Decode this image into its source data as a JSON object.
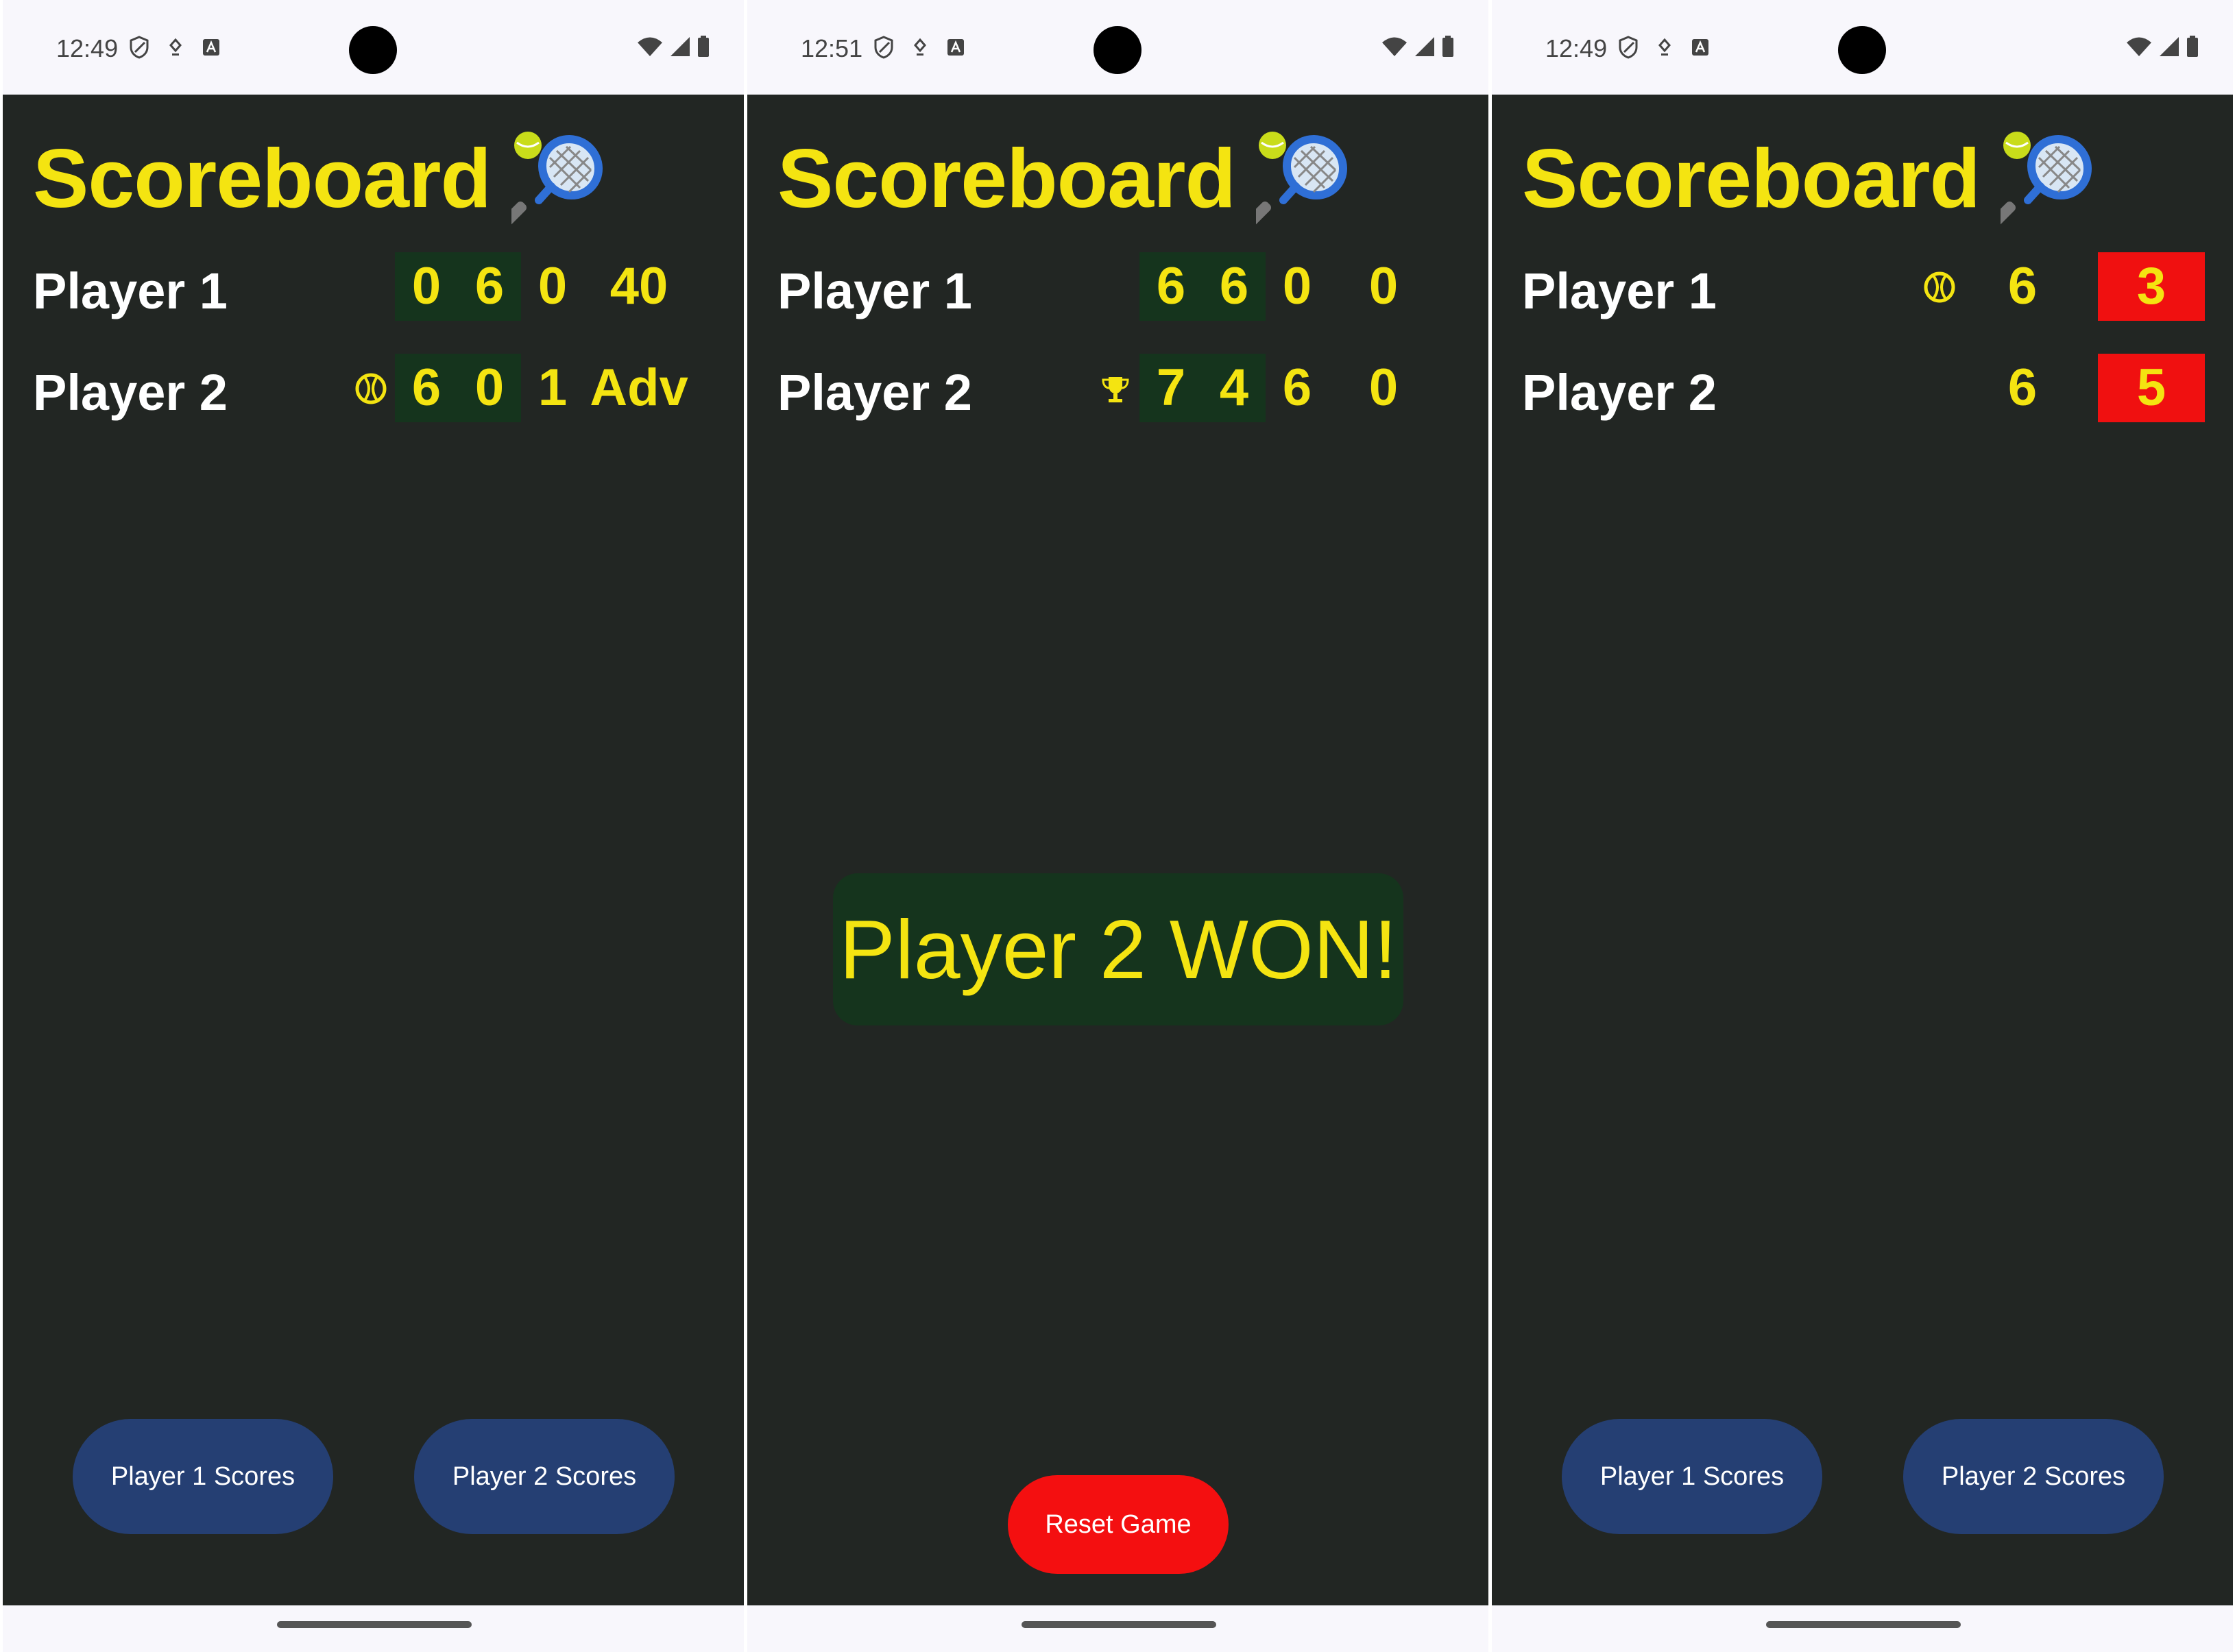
{
  "screens": [
    {
      "status": {
        "time": "12:49"
      },
      "title": "Scoreboard",
      "players": [
        {
          "name": "Player 1",
          "cells": [
            "0",
            "6",
            "0",
            "40"
          ],
          "marker": ""
        },
        {
          "name": "Player 2",
          "cells": [
            "6",
            "0",
            "1",
            "Adv"
          ],
          "marker": "tennis-ball-icon"
        }
      ],
      "buttons": {
        "player1": "Player 1 Scores",
        "player2": "Player 2 Scores"
      }
    },
    {
      "status": {
        "time": "12:51"
      },
      "title": "Scoreboard",
      "players": [
        {
          "name": "Player 1",
          "cells": [
            "6",
            "6",
            "0",
            "0"
          ],
          "marker": ""
        },
        {
          "name": "Player 2",
          "cells": [
            "7",
            "4",
            "6",
            "0"
          ],
          "marker": "trophy-icon"
        }
      ],
      "message": "Player 2 WON!",
      "buttons": {
        "reset": "Reset Game"
      }
    },
    {
      "status": {
        "time": "12:49"
      },
      "title": "Scoreboard",
      "players": [
        {
          "name": "Player 1",
          "cells": [
            "6",
            "3"
          ],
          "marker": "tennis-ball-icon"
        },
        {
          "name": "Player 2",
          "cells": [
            "6",
            "5"
          ],
          "marker": ""
        }
      ],
      "buttons": {
        "player1": "Player 1 Scores",
        "player2": "Player 2 Scores"
      }
    }
  ],
  "colors": {
    "background": "#222623",
    "score_text": "#f4e411",
    "set_cell_bg": "#15341d",
    "tiebreak_cell_bg": "#f01010",
    "score_button": "#253f73",
    "reset_button": "#f40f10"
  }
}
